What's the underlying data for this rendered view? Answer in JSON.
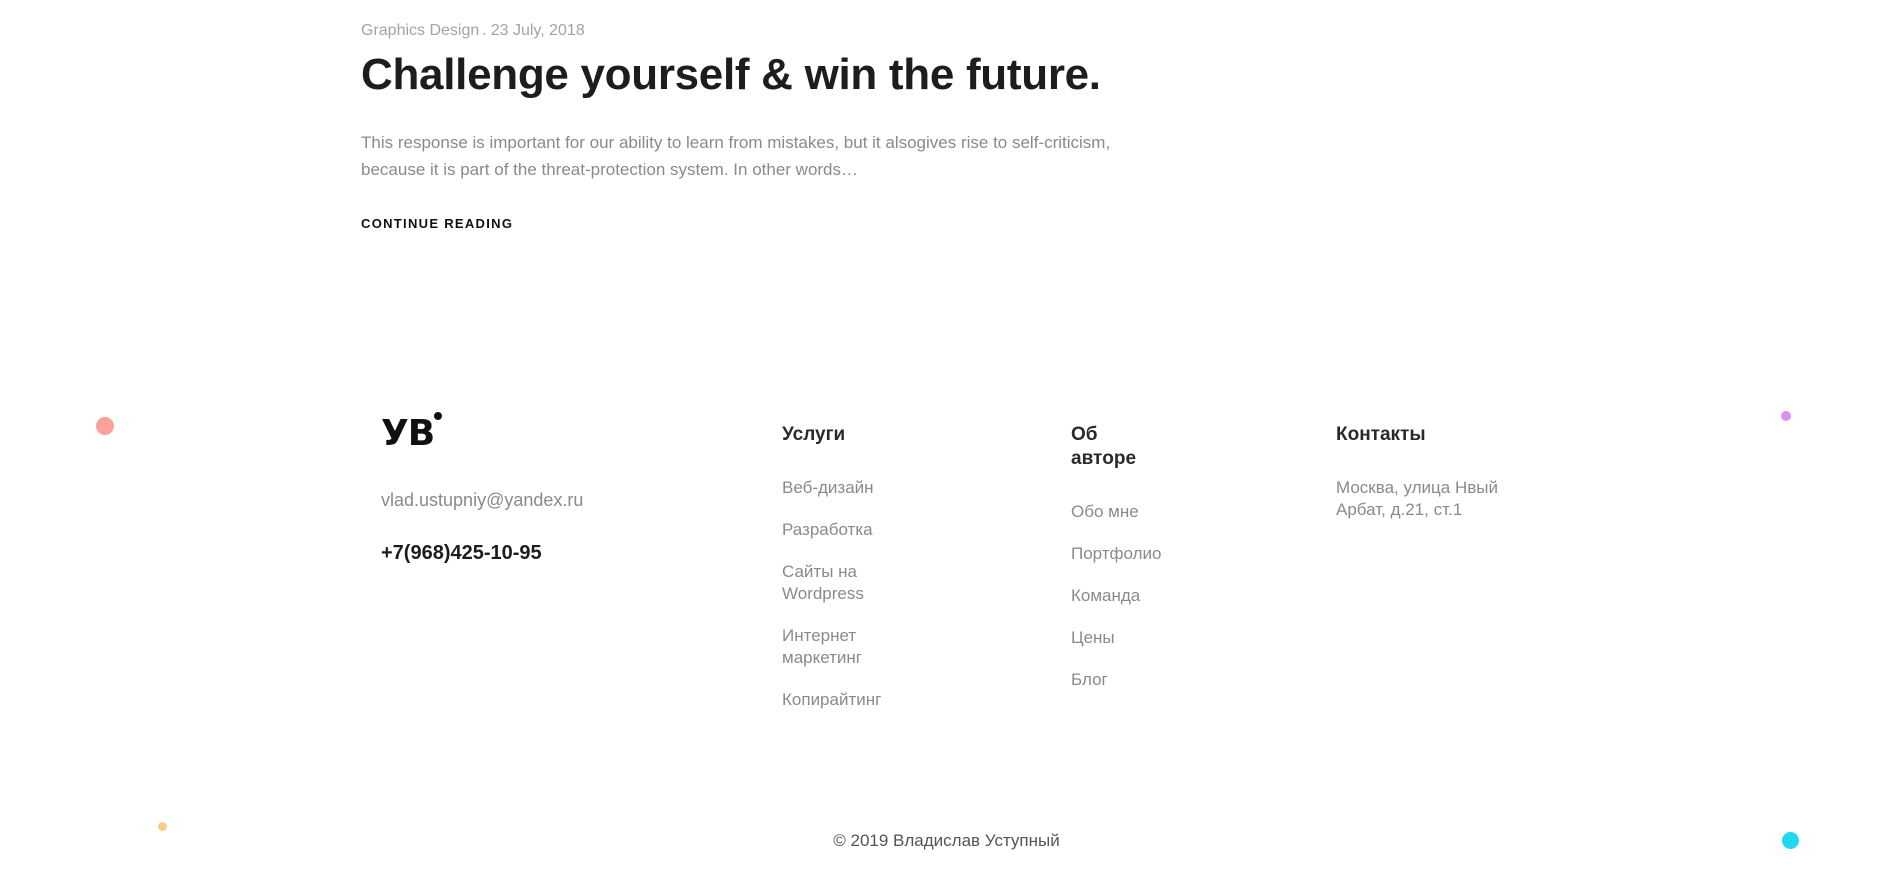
{
  "article": {
    "category": "Graphics Design",
    "separator": ".",
    "date": "23 July, 2018",
    "title": "Challenge yourself & win the future.",
    "excerpt": "This response is important for our ability to learn from mistakes, but it alsogives rise to self-criticism, because it is part of the threat-protection system. In other words…",
    "continue_label": "CONTINUE READING"
  },
  "footer": {
    "logo_text": "УВ",
    "email": "vlad.ustupniy@yandex.ru",
    "phone": "+7(968)425-10-95",
    "services": {
      "heading": "Услуги",
      "items": [
        "Веб-дизайн",
        "Разработка",
        "Сайты на Wordpress",
        "Интернет маркетинг",
        "Копирайтинг"
      ]
    },
    "about": {
      "heading": "Об автope",
      "items": [
        "Обо мне",
        "Портфолио",
        "Команда",
        "Цены",
        "Блог"
      ]
    },
    "contacts": {
      "heading": "Контакты",
      "address": "Москва, улица Нвый Арбат, д.21, ст.1"
    },
    "copyright": "© 2019 Владислав Уступный"
  },
  "decor_colors": {
    "coral": "#f9a19a",
    "violet": "#dd8cf5",
    "peach": "#fbcb88",
    "cyan": "#22d8f0"
  }
}
